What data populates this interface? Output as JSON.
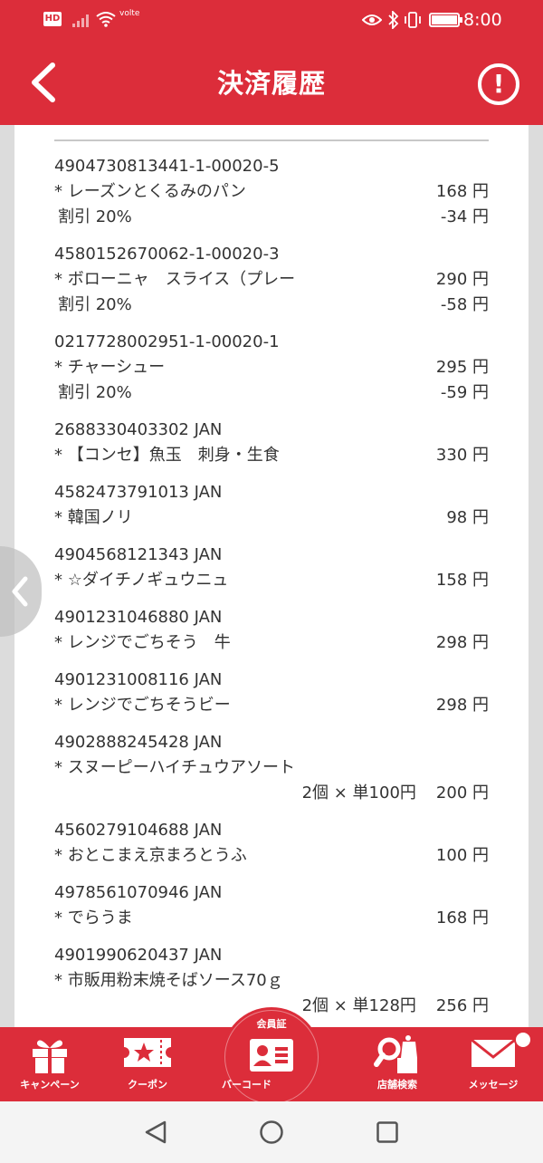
{
  "status_bar": {
    "hd_label": "HD",
    "volte_label": "volte",
    "time": "8:00",
    "icons": [
      "eye-icon",
      "bluetooth-icon",
      "vibrate-icon",
      "battery-icon"
    ]
  },
  "header": {
    "title": "決済履歴",
    "info_label": "!"
  },
  "receipt": {
    "items": [
      {
        "code": "4904730813441-1-00020-5",
        "name": "* レーズンとくるみのパン",
        "price": "168 円",
        "discount_label": "割引 20%",
        "discount_price": "-34 円"
      },
      {
        "code": "4580152670062-1-00020-3",
        "name": "* ボローニャ　スライス（プレー",
        "price": "290 円",
        "discount_label": "割引 20%",
        "discount_price": "-58 円"
      },
      {
        "code": "0217728002951-1-00020-1",
        "name": "* チャーシュー",
        "price": "295 円",
        "discount_label": "割引 20%",
        "discount_price": "-59 円"
      },
      {
        "code": "2688330403302 JAN",
        "name": "* 【コンセ】魚玉　刺身・生食",
        "price": "330 円"
      },
      {
        "code": "4582473791013 JAN",
        "name": "* 韓国ノリ",
        "price": "98 円"
      },
      {
        "code": "4904568121343 JAN",
        "name": "* ☆ダイチノギュウニュ",
        "price": "158 円"
      },
      {
        "code": "4901231046880 JAN",
        "name": "* レンジでごちそう　牛",
        "price": "298 円"
      },
      {
        "code": "4901231008116 JAN",
        "name": "* レンジでごちそうビー",
        "price": "298 円"
      },
      {
        "code": "4902888245428 JAN",
        "name": "* スヌーピーハイチュウアソート",
        "quantity_label": "2個 × 単100円",
        "price": "200 円"
      },
      {
        "code": "4560279104688 JAN",
        "name": "* おとこまえ京まろとうふ",
        "price": "100 円"
      },
      {
        "code": "4978561070946 JAN",
        "name": "* でらうま",
        "price": "168 円"
      },
      {
        "code": "4901990620437 JAN",
        "name": "* 市販用粉末焼そばソース70ｇ",
        "quantity_label": "2個 × 単128円",
        "price": "256 円"
      }
    ]
  },
  "bottom_nav": {
    "campaign": "キャンペーン",
    "coupon": "クーポン",
    "member_card": "会員証",
    "barcode": "バーコード",
    "store_search": "店舗検索",
    "message": "メッセージ"
  },
  "colors": {
    "brand_red": "#dc2d3a",
    "text": "#333333",
    "background": "#dcdcdc"
  }
}
